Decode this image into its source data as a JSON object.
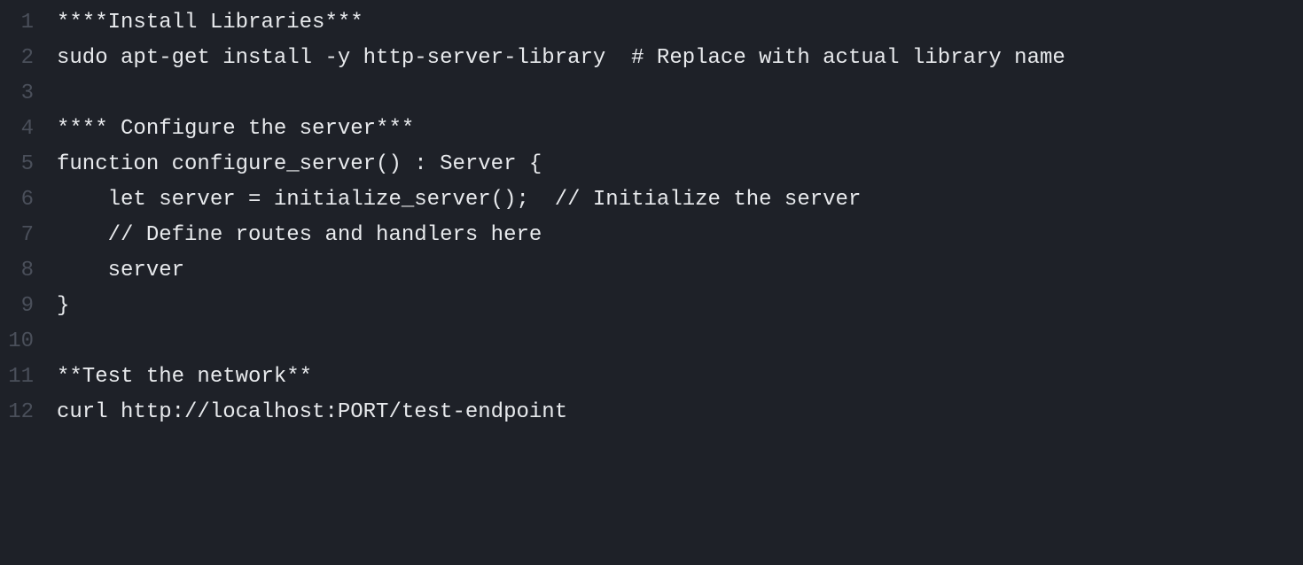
{
  "editor": {
    "lineNumbers": [
      "1",
      "2",
      "3",
      "4",
      "5",
      "6",
      "7",
      "8",
      "9",
      "10",
      "11",
      "12"
    ],
    "lines": [
      "****Install Libraries***",
      "sudo apt-get install -y http-server-library  # Replace with actual library name",
      "",
      "**** Configure the server***",
      "function configure_server() : Server {",
      "    let server = initialize_server();  // Initialize the server",
      "    // Define routes and handlers here",
      "    server",
      "}",
      "",
      "**Test the network**",
      "curl http://localhost:PORT/test-endpoint"
    ]
  }
}
